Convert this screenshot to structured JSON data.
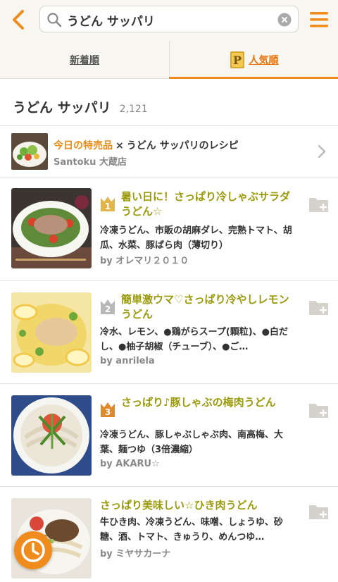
{
  "search": {
    "query": "うどん サッパリ"
  },
  "tabs": [
    {
      "label": "新着順",
      "active": false
    },
    {
      "label": "人気順",
      "active": true
    }
  ],
  "heading": {
    "title": "うどん サッパリ",
    "count": "2,121"
  },
  "promo": {
    "accent": "今日の特売品",
    "connector": "×",
    "text": "うどん サッパリのレシピ",
    "store": "Santoku 大蔵店"
  },
  "recipes": [
    {
      "rank": "1",
      "title": "暑い日に！さっぱり冷しゃぶサラダうどん☆",
      "ingredients": "冷凍うどん、市販の胡麻ダレ、完熟トマト、胡瓜、水菜、豚ばら肉（薄切り）",
      "author": "by オレマリ２０１０"
    },
    {
      "rank": "2",
      "title": "簡単激ウマ♡さっぱり冷やしレモンうどん",
      "ingredients": "冷水、レモン、●鶏がらスープ(顆粒)、●白だし、●柚子胡椒（チューブ）、●ご…",
      "author": "by anrilela"
    },
    {
      "rank": "3",
      "title": "さっぱり♪豚しゃぶの梅肉うどん",
      "ingredients": "冷凍うどん、豚しゃぶしゃぶ肉、南高梅、大葉、麺つゆ（3倍濃縮）",
      "author": "by AKARU☆"
    },
    {
      "rank": "",
      "title": "さっぱり美味しい☆ひき肉うどん",
      "ingredients": "牛ひき肉、冷凍うどん、味噌、しょうゆ、砂糖、酒、トマト、きゅうり、めんつゆ…",
      "author": "by ミヤサカーナ"
    }
  ],
  "colors": {
    "accent": "#f08c1e",
    "title": "#9a9a0b",
    "gold": "#e2b54a",
    "silver": "#b8b8b8",
    "bronze": "#e08a2c"
  }
}
